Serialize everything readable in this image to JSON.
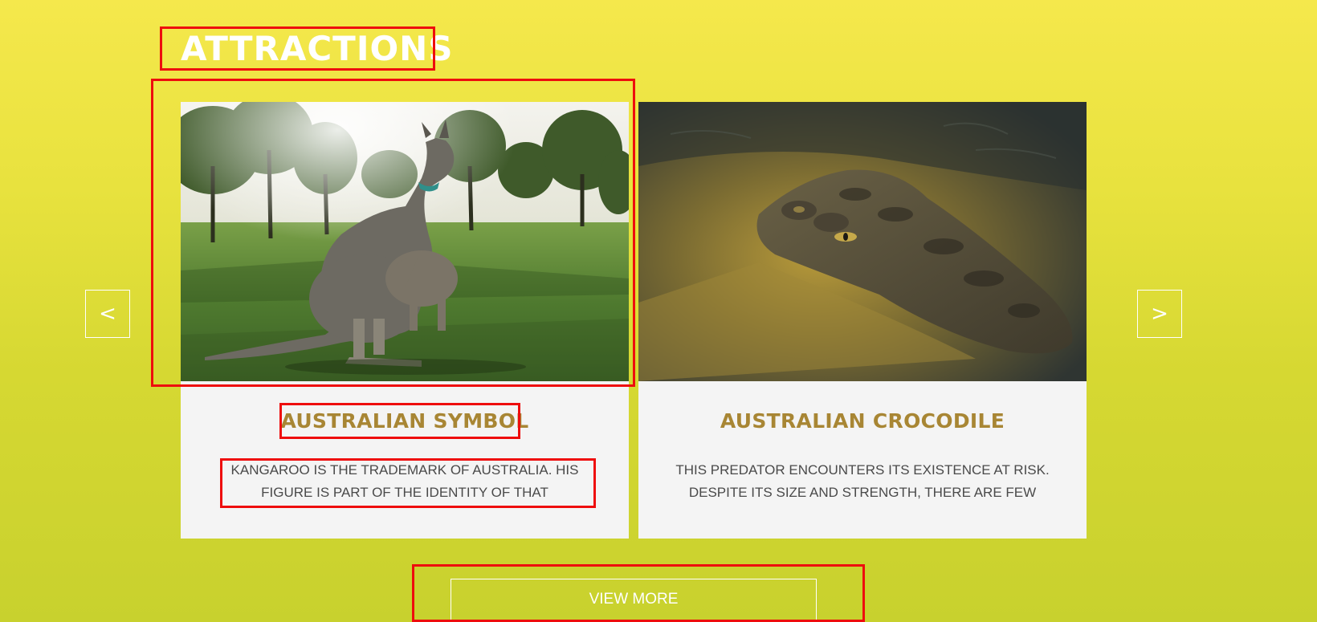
{
  "section": {
    "title": "ATTRACTIONS"
  },
  "carousel": {
    "prev_label": "<",
    "next_label": ">",
    "cards": [
      {
        "image": "kangaroo-photo",
        "title": "AUSTRALIAN SYMBOL",
        "description": "KANGAROO IS THE TRADEMARK OF AUSTRALIA. HIS FIGURE IS PART OF THE IDENTITY OF THAT"
      },
      {
        "image": "crocodile-photo",
        "title": "AUSTRALIAN CROCODILE",
        "description": "THIS PREDATOR ENCOUNTERS ITS EXISTENCE AT RISK. DESPITE ITS SIZE AND STRENGTH, THERE ARE FEW"
      }
    ]
  },
  "footer": {
    "view_more_label": "VIEW MORE"
  },
  "colors": {
    "background_top": "#f5e84c",
    "background_bottom": "#c8d12e",
    "card_title": "#a88634",
    "highlight": "#ee0d0d"
  }
}
